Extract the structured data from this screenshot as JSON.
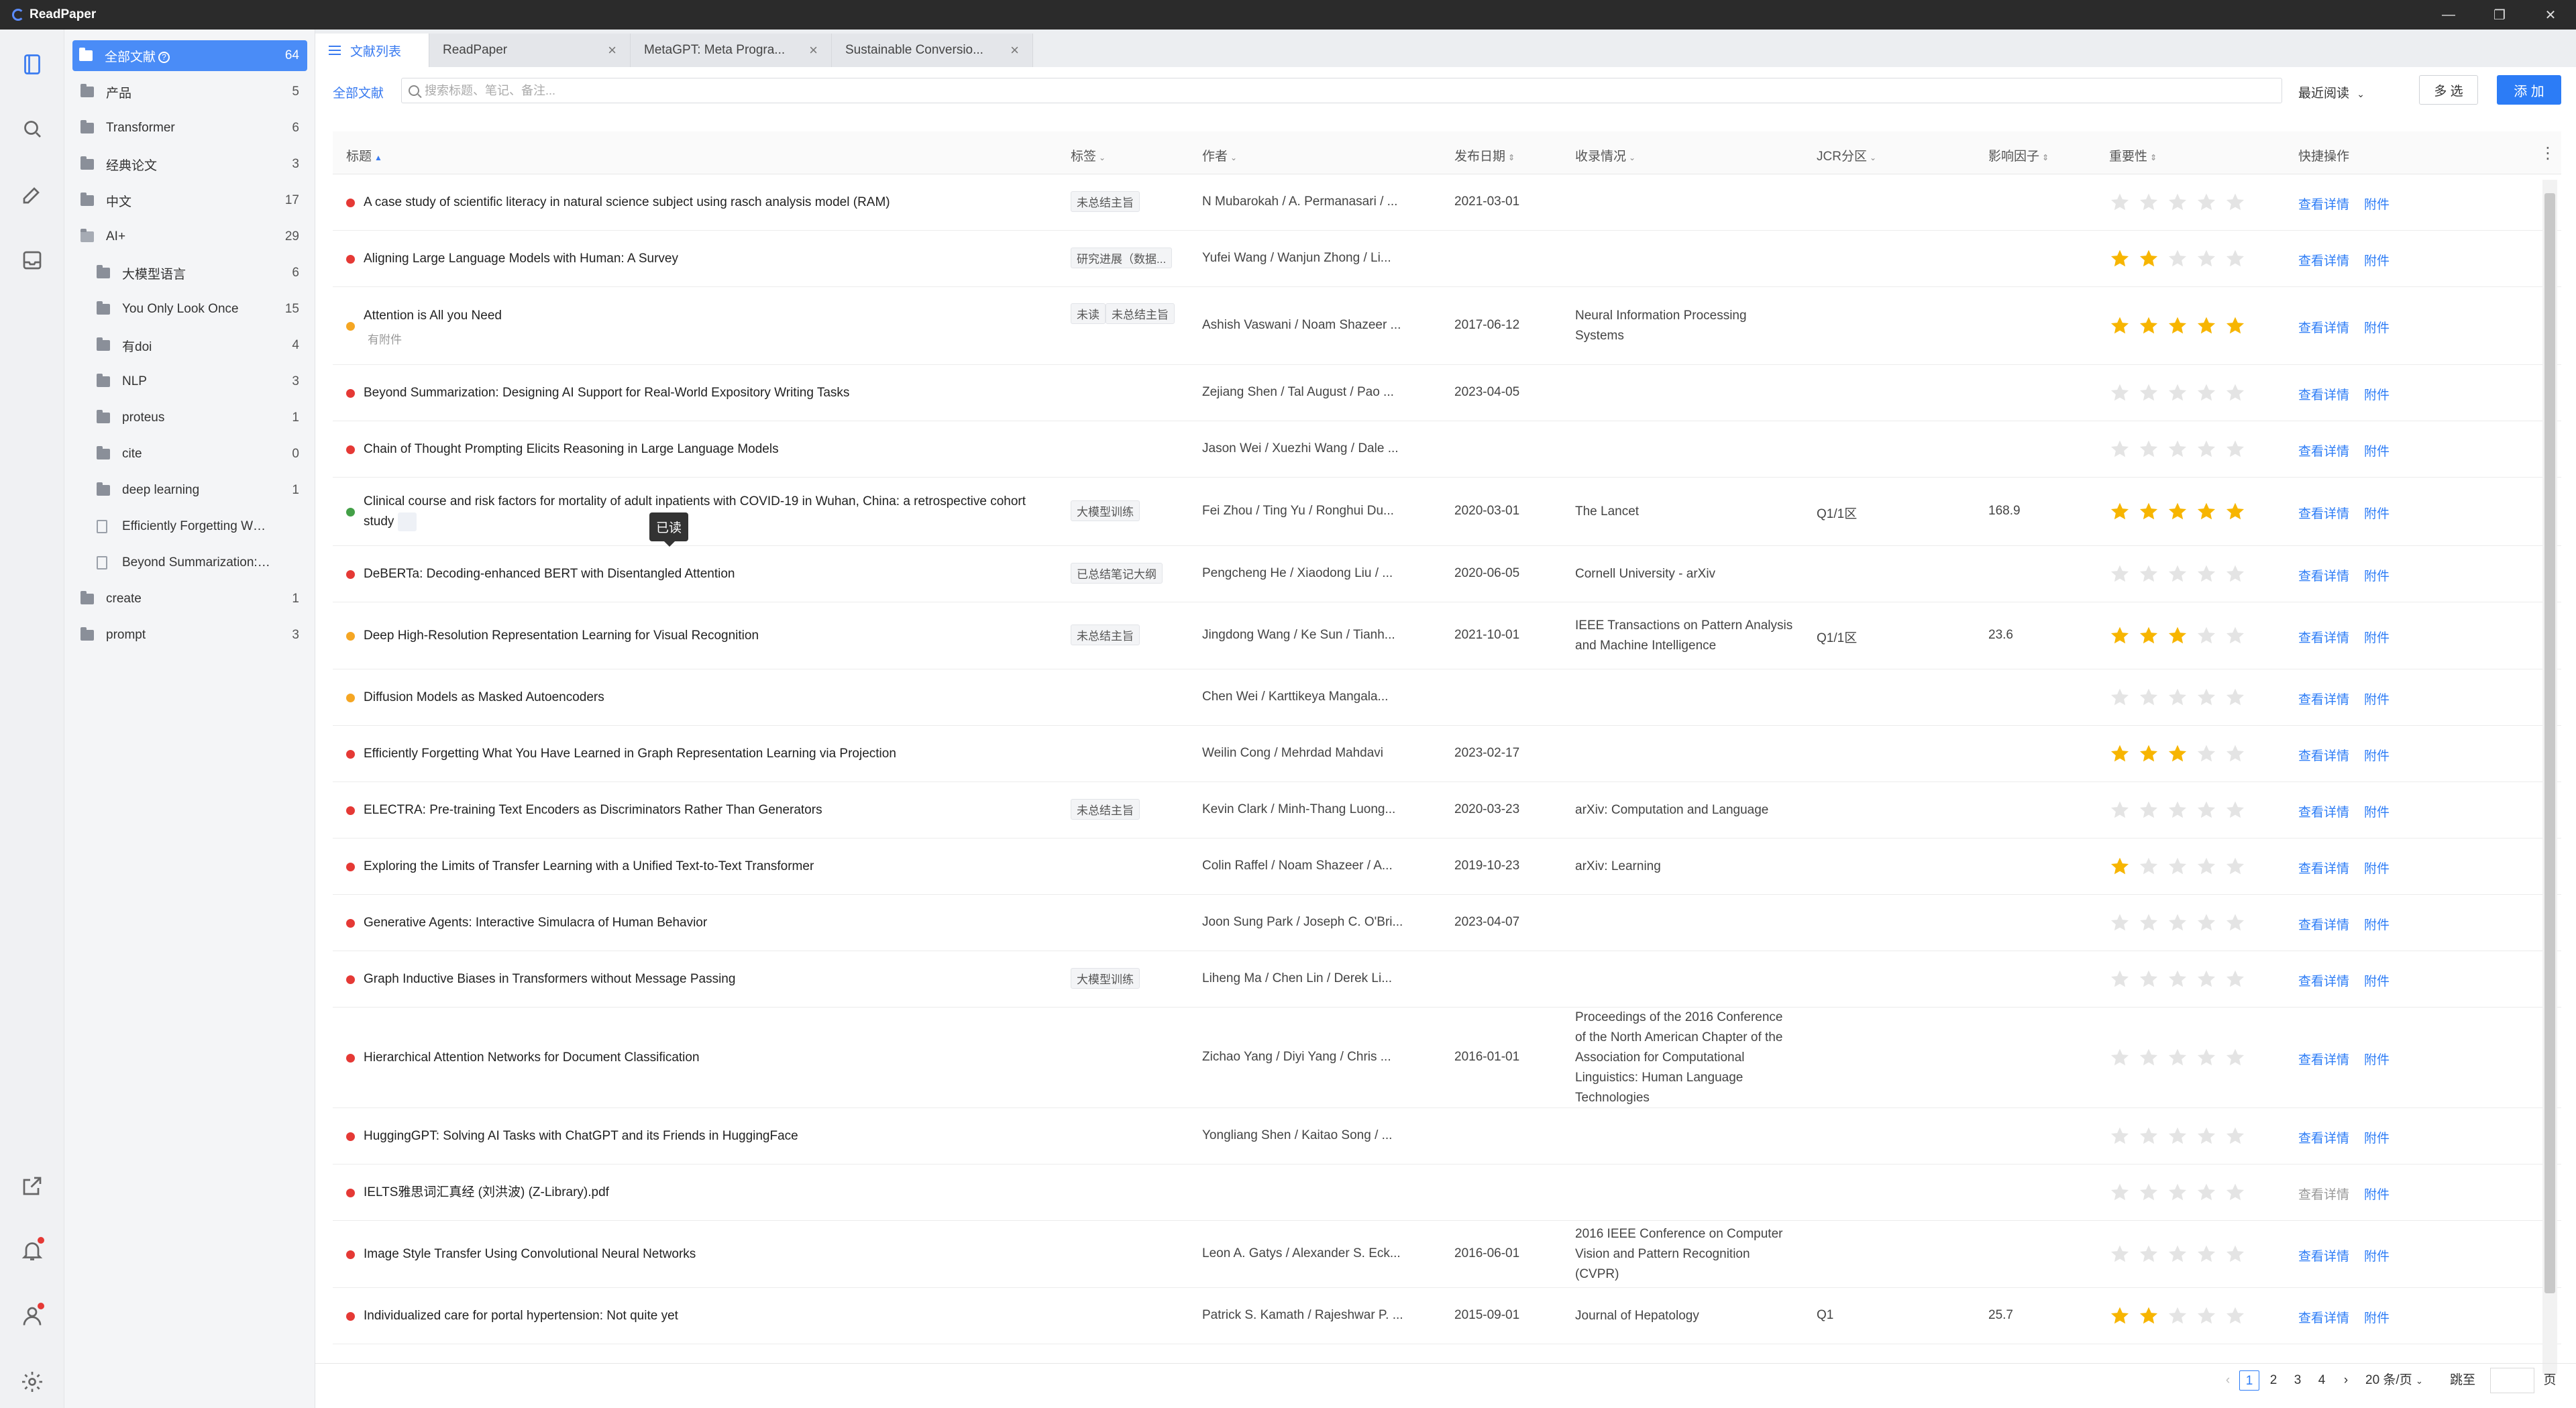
{
  "app": {
    "title": "ReadPaper"
  },
  "sidebar": {
    "folders": [
      {
        "label": "全部文献",
        "count": "64"
      },
      {
        "label": "产品",
        "count": "5"
      },
      {
        "label": "Transformer",
        "count": "6"
      },
      {
        "label": "经典论文",
        "count": "3"
      },
      {
        "label": "中文",
        "count": "17"
      },
      {
        "label": "AI+",
        "count": "29"
      },
      {
        "label": "大模型语言",
        "count": "6"
      },
      {
        "label": "You Only Look Once",
        "count": "15"
      },
      {
        "label": "有doi",
        "count": "4"
      },
      {
        "label": "NLP",
        "count": "3"
      },
      {
        "label": "proteus",
        "count": "1"
      },
      {
        "label": "cite",
        "count": "0"
      },
      {
        "label": "deep learning",
        "count": "1"
      },
      {
        "label": "Efficiently Forgetting What You...",
        "count": ""
      },
      {
        "label": "Beyond Summarization: Desig...",
        "count": ""
      },
      {
        "label": "create",
        "count": "1"
      },
      {
        "label": "prompt",
        "count": "3"
      }
    ]
  },
  "tabs": [
    {
      "label": "文献列表"
    },
    {
      "label": "ReadPaper"
    },
    {
      "label": "MetaGPT: Meta Progra..."
    },
    {
      "label": "Sustainable Conversio..."
    }
  ],
  "toolbar": {
    "all_label": "全部文献",
    "search_placeholder": "搜索标题、笔记、备注...",
    "sort_label": "最近阅读",
    "multi_label": "多 选",
    "add_label": "添 加"
  },
  "table": {
    "headers": {
      "title": "标题",
      "tags": "标签",
      "author": "作者",
      "date": "发布日期",
      "venue": "收录情况",
      "jcr": "JCR分区",
      "impact": "影响因子",
      "importance": "重要性",
      "actions": "快捷操作"
    },
    "view_label": "查看详情",
    "attach_label": "附件",
    "tooltip": "已读",
    "rows": [
      {
        "title": "A case study of scientific literacy in natural science subject using rasch analysis model (RAM)",
        "tags": [
          "未总结主旨"
        ],
        "author": "N Mubarokah / A. Permanasari / ...",
        "date": "2021-03-01",
        "venue": "",
        "jcr": "",
        "impact": "",
        "stars": 0,
        "status": "#e53935"
      },
      {
        "title": "Aligning Large Language Models with Human: A Survey",
        "tags": [
          "研究进展（数据..."
        ],
        "author": "Yufei Wang / Wanjun Zhong / Li...",
        "date": "",
        "venue": "",
        "jcr": "",
        "impact": "",
        "stars": 2,
        "status": "#e53935"
      },
      {
        "title": "Attention is All you Need",
        "sub": "有附件",
        "tags": [
          "未读",
          "未总结主旨"
        ],
        "author": "Ashish Vaswani / Noam Shazeer ...",
        "date": "2017-06-12",
        "venue": "Neural Information Processing Systems",
        "jcr": "",
        "impact": "",
        "stars": 5,
        "status": "#f5a623"
      },
      {
        "title": "Beyond Summarization: Designing AI Support for Real-World Expository Writing Tasks",
        "tags": [],
        "author": "Zejiang Shen / Tal August / Pao ...",
        "date": "2023-04-05",
        "venue": "",
        "jcr": "",
        "impact": "",
        "stars": 0,
        "status": "#e53935"
      },
      {
        "title": "Chain of Thought Prompting Elicits Reasoning in Large Language Models",
        "tags": [],
        "author": "Jason Wei / Xuezhi Wang / Dale ...",
        "date": "",
        "venue": "",
        "jcr": "",
        "impact": "",
        "stars": 0,
        "status": "#e53935"
      },
      {
        "title": "Clinical course and risk factors for mortality of adult inpatients with COVID-19 in Wuhan, China: a retrospective cohort study",
        "tags": [
          "大模型训练"
        ],
        "author": "Fei Zhou / Ting Yu / Ronghui Du...",
        "date": "2020-03-01",
        "venue": "The Lancet",
        "jcr": "Q1/1区",
        "impact": "168.9",
        "stars": 5,
        "status": "#43a047"
      },
      {
        "title": "DeBERTa: Decoding-enhanced BERT with Disentangled Attention",
        "tags": [
          "已总结笔记大纲"
        ],
        "author": "Pengcheng He / Xiaodong Liu / ...",
        "date": "2020-06-05",
        "venue": "Cornell University - arXiv",
        "jcr": "",
        "impact": "",
        "stars": 0,
        "status": "#e53935"
      },
      {
        "title": "Deep High-Resolution Representation Learning for Visual Recognition",
        "tags": [
          "未总结主旨"
        ],
        "author": "Jingdong Wang / Ke Sun / Tianh...",
        "date": "2021-10-01",
        "venue": "IEEE Transactions on Pattern Analysis and Machine Intelligence",
        "jcr": "Q1/1区",
        "impact": "23.6",
        "stars": 3,
        "status": "#f5a623"
      },
      {
        "title": "Diffusion Models as Masked Autoencoders",
        "tags": [],
        "author": "Chen Wei / Karttikeya Mangala...",
        "date": "",
        "venue": "",
        "jcr": "",
        "impact": "",
        "stars": 0,
        "status": "#f5a623"
      },
      {
        "title": "Efficiently Forgetting What You Have Learned in Graph Representation Learning via Projection",
        "tags": [],
        "author": "Weilin Cong / Mehrdad Mahdavi",
        "date": "2023-02-17",
        "venue": "",
        "jcr": "",
        "impact": "",
        "stars": 3,
        "status": "#e53935"
      },
      {
        "title": "ELECTRA: Pre-training Text Encoders as Discriminators Rather Than Generators",
        "tags": [
          "未总结主旨"
        ],
        "author": "Kevin Clark / Minh-Thang Luong...",
        "date": "2020-03-23",
        "venue": "arXiv: Computation and Language",
        "jcr": "",
        "impact": "",
        "stars": 0,
        "status": "#e53935"
      },
      {
        "title": "Exploring the Limits of Transfer Learning with a Unified Text-to-Text Transformer",
        "tags": [],
        "author": "Colin Raffel / Noam Shazeer / A...",
        "date": "2019-10-23",
        "venue": "arXiv: Learning",
        "jcr": "",
        "impact": "",
        "stars": 1,
        "status": "#e53935"
      },
      {
        "title": "Generative Agents: Interactive Simulacra of Human Behavior",
        "tags": [],
        "author": "Joon Sung Park / Joseph C. O'Bri...",
        "date": "2023-04-07",
        "venue": "",
        "jcr": "",
        "impact": "",
        "stars": 0,
        "status": "#e53935"
      },
      {
        "title": "Graph Inductive Biases in Transformers without Message Passing",
        "tags": [
          "大模型训练"
        ],
        "author": "Liheng Ma / Chen Lin / Derek Li...",
        "date": "",
        "venue": "",
        "jcr": "",
        "impact": "",
        "stars": 0,
        "status": "#e53935"
      },
      {
        "title": "Hierarchical Attention Networks for Document Classification",
        "tags": [],
        "author": "Zichao Yang / Diyi Yang / Chris ...",
        "date": "2016-01-01",
        "venue": "Proceedings of the 2016 Conference of the North American Chapter of the Association for Computational Linguistics: Human Language Technologies",
        "jcr": "",
        "impact": "",
        "stars": 0,
        "status": "#e53935"
      },
      {
        "title": "HuggingGPT: Solving AI Tasks with ChatGPT and its Friends in HuggingFace",
        "tags": [],
        "author": "Yongliang Shen / Kaitao Song / ...",
        "date": "",
        "venue": "",
        "jcr": "",
        "impact": "",
        "stars": 0,
        "status": "#e53935"
      },
      {
        "title": "IELTS雅思词汇真经 (刘洪波) (Z-Library).pdf",
        "tags": [],
        "author": "",
        "date": "",
        "venue": "",
        "jcr": "",
        "impact": "",
        "stars": 0,
        "status": "#e53935",
        "dim_view": true
      },
      {
        "title": "Image Style Transfer Using Convolutional Neural Networks",
        "tags": [],
        "author": "Leon A. Gatys / Alexander S. Eck...",
        "date": "2016-06-01",
        "venue": "2016 IEEE Conference on Computer Vision and Pattern Recognition (CVPR)",
        "jcr": "",
        "impact": "",
        "stars": 0,
        "status": "#e53935"
      },
      {
        "title": "Individualized care for portal hypertension: Not quite yet",
        "tags": [],
        "author": "Patrick S. Kamath / Rajeshwar P. ...",
        "date": "2015-09-01",
        "venue": "Journal of Hepatology",
        "jcr": "Q1",
        "impact": "25.7",
        "stars": 2,
        "status": "#e53935"
      }
    ]
  },
  "pager": {
    "pages": [
      "1",
      "2",
      "3",
      "4"
    ],
    "current": "1",
    "page_size": "20 条/页",
    "jump_label": "跳至",
    "page_suffix": "页"
  },
  "colors": {
    "accent": "#2c7cf6",
    "star_on": "#f7b500",
    "star_off": "#e4e4e4"
  }
}
